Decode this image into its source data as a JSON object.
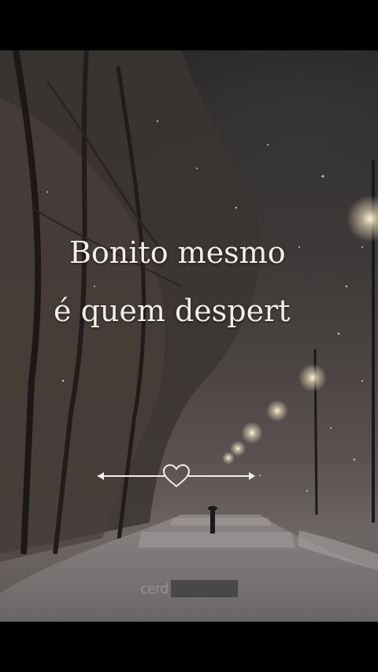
{
  "quote": {
    "line1": "Bonito mesmo",
    "line2": "é quem despert"
  },
  "watermark": {
    "text": "cerd"
  },
  "icons": {
    "divider": "heart-arrow-icon"
  },
  "colors": {
    "text": "#f2efea",
    "background": "#000000"
  }
}
